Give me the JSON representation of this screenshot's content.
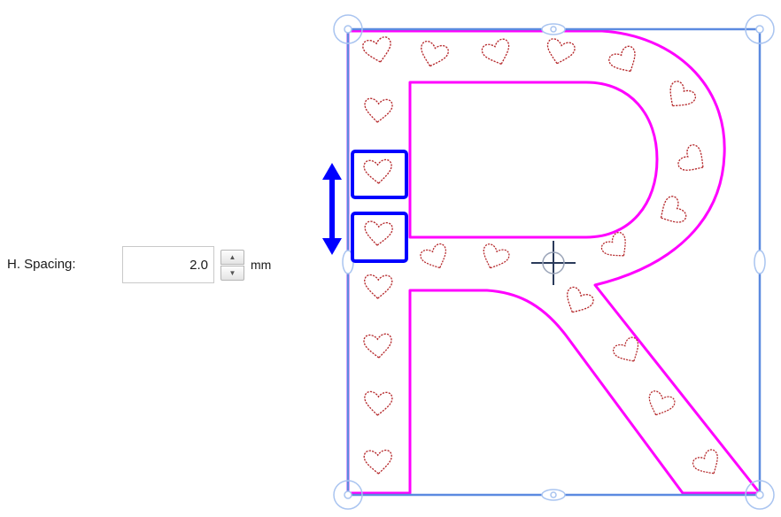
{
  "spacing": {
    "label": "H. Spacing:",
    "value": "2.0",
    "unit": "mm",
    "up_glyph": "▲",
    "down_glyph": "▼"
  },
  "canvas": {
    "letter": "R",
    "fill_motif": "heart-icon",
    "colors": {
      "outline": "#ff00ff",
      "stitch": "#b5282b",
      "selection": "#5b8ae0",
      "handle": "#a9c4f0",
      "highlight": "#0000ff",
      "crosshair": "#2a3a5a"
    }
  }
}
